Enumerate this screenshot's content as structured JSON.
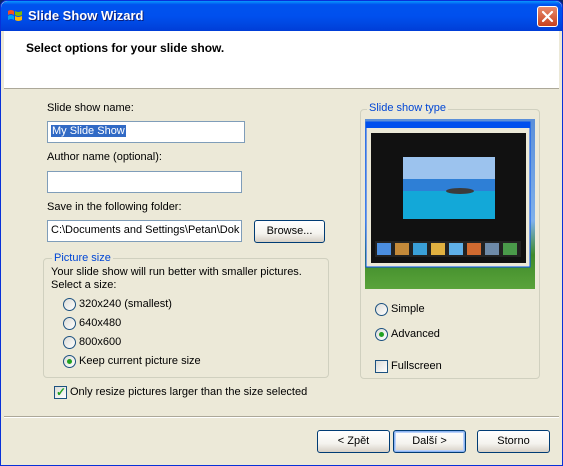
{
  "window": {
    "title": "Slide Show Wizard"
  },
  "header": {
    "text": "Select options for your slide show."
  },
  "form": {
    "slide_show_name_label": "Slide show name:",
    "slide_show_name_value": "My Slide Show",
    "author_label": "Author name (optional):",
    "author_value": "",
    "folder_label": "Save in the following folder:",
    "folder_value": "C:\\Documents and Settings\\Petan\\Dok",
    "browse_label": "Browse..."
  },
  "picture_size": {
    "title": "Picture size",
    "description": "Your slide show will run better with smaller pictures.",
    "select_label": "Select a size:",
    "options": [
      "320x240 (smallest)",
      "640x480",
      "800x600",
      "Keep current picture size"
    ],
    "selected_index": 3
  },
  "resize_checkbox": {
    "label": "Only resize pictures larger than the size selected",
    "checked": true
  },
  "slide_show_type": {
    "title": "Slide show type",
    "options": [
      "Simple",
      "Advanced"
    ],
    "selected_index": 1,
    "fullscreen_label": "Fullscreen",
    "fullscreen_checked": false
  },
  "buttons": {
    "back": "< Zpět",
    "next": "Další >",
    "cancel": "Storno"
  },
  "colors": {
    "title_bar": "#0053ee",
    "group_title": "#0046d5",
    "radio_on": "#21a121"
  }
}
